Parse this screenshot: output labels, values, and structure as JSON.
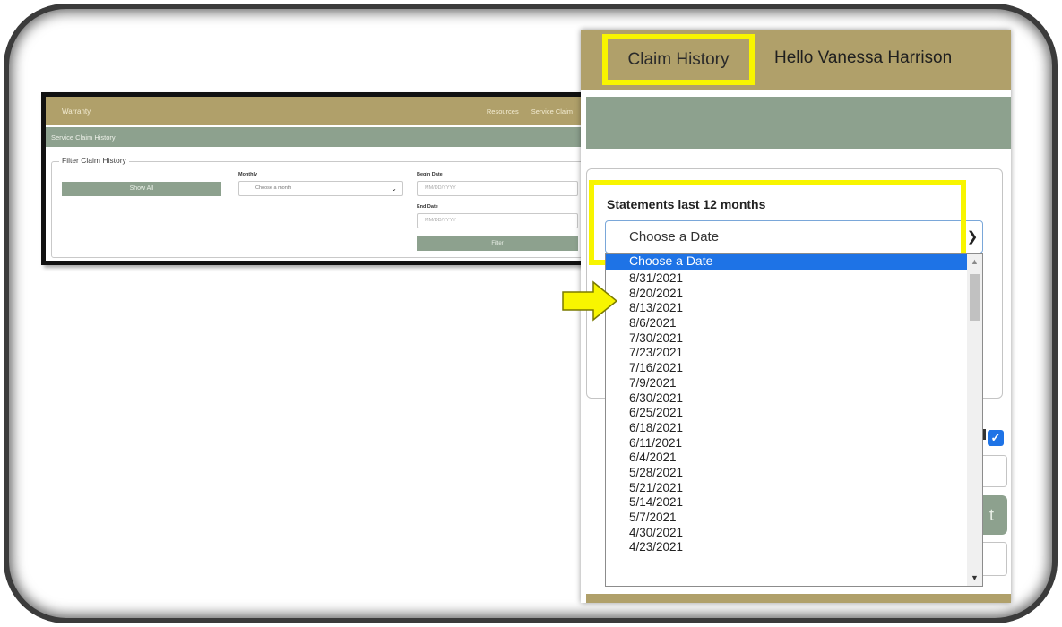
{
  "mini": {
    "brand": "Warranty",
    "nav": [
      "Resources",
      "Service Claim"
    ],
    "subheader": "Service Claim History",
    "legend": "Filter Claim History",
    "show_all": "Show All",
    "monthly_label": "Monthly",
    "monthly_placeholder": "Choose a month",
    "begin_label": "Begin Date",
    "begin_placeholder": "MM/DD/YYYY",
    "end_label": "End Date",
    "end_placeholder": "MM/DD/YYYY",
    "filter": "Filter"
  },
  "panel": {
    "tab": "Claim History",
    "greeting": "Hello Vanessa Harrison",
    "statements_label": "Statements last 12 months",
    "select_value": "Choose a Date",
    "dropdown_selected": "Choose a Date",
    "dates": [
      "8/31/2021",
      "8/20/2021",
      "8/13/2021",
      "8/6/2021",
      "7/30/2021",
      "7/23/2021",
      "7/16/2021",
      "7/9/2021",
      "6/30/2021",
      "6/25/2021",
      "6/18/2021",
      "6/11/2021",
      "6/4/2021",
      "5/28/2021",
      "5/21/2021",
      "5/14/2021",
      "5/7/2021",
      "4/30/2021",
      "4/23/2021"
    ],
    "side_button_fragment": "t"
  },
  "colors": {
    "gold": "#b0a06a",
    "sage": "#8da18e",
    "highlight": "#f8f500",
    "selection": "#1e73e6"
  }
}
